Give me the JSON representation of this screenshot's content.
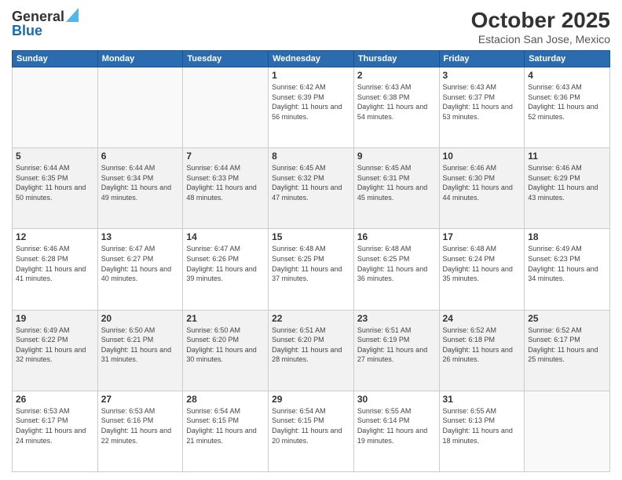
{
  "header": {
    "logo_general": "General",
    "logo_blue": "Blue",
    "month": "October 2025",
    "location": "Estacion San Jose, Mexico"
  },
  "weekdays": [
    "Sunday",
    "Monday",
    "Tuesday",
    "Wednesday",
    "Thursday",
    "Friday",
    "Saturday"
  ],
  "weeks": [
    [
      {
        "day": "",
        "info": ""
      },
      {
        "day": "",
        "info": ""
      },
      {
        "day": "",
        "info": ""
      },
      {
        "day": "1",
        "info": "Sunrise: 6:42 AM\nSunset: 6:39 PM\nDaylight: 11 hours and 56 minutes."
      },
      {
        "day": "2",
        "info": "Sunrise: 6:43 AM\nSunset: 6:38 PM\nDaylight: 11 hours and 54 minutes."
      },
      {
        "day": "3",
        "info": "Sunrise: 6:43 AM\nSunset: 6:37 PM\nDaylight: 11 hours and 53 minutes."
      },
      {
        "day": "4",
        "info": "Sunrise: 6:43 AM\nSunset: 6:36 PM\nDaylight: 11 hours and 52 minutes."
      }
    ],
    [
      {
        "day": "5",
        "info": "Sunrise: 6:44 AM\nSunset: 6:35 PM\nDaylight: 11 hours and 50 minutes."
      },
      {
        "day": "6",
        "info": "Sunrise: 6:44 AM\nSunset: 6:34 PM\nDaylight: 11 hours and 49 minutes."
      },
      {
        "day": "7",
        "info": "Sunrise: 6:44 AM\nSunset: 6:33 PM\nDaylight: 11 hours and 48 minutes."
      },
      {
        "day": "8",
        "info": "Sunrise: 6:45 AM\nSunset: 6:32 PM\nDaylight: 11 hours and 47 minutes."
      },
      {
        "day": "9",
        "info": "Sunrise: 6:45 AM\nSunset: 6:31 PM\nDaylight: 11 hours and 45 minutes."
      },
      {
        "day": "10",
        "info": "Sunrise: 6:46 AM\nSunset: 6:30 PM\nDaylight: 11 hours and 44 minutes."
      },
      {
        "day": "11",
        "info": "Sunrise: 6:46 AM\nSunset: 6:29 PM\nDaylight: 11 hours and 43 minutes."
      }
    ],
    [
      {
        "day": "12",
        "info": "Sunrise: 6:46 AM\nSunset: 6:28 PM\nDaylight: 11 hours and 41 minutes."
      },
      {
        "day": "13",
        "info": "Sunrise: 6:47 AM\nSunset: 6:27 PM\nDaylight: 11 hours and 40 minutes."
      },
      {
        "day": "14",
        "info": "Sunrise: 6:47 AM\nSunset: 6:26 PM\nDaylight: 11 hours and 39 minutes."
      },
      {
        "day": "15",
        "info": "Sunrise: 6:48 AM\nSunset: 6:25 PM\nDaylight: 11 hours and 37 minutes."
      },
      {
        "day": "16",
        "info": "Sunrise: 6:48 AM\nSunset: 6:25 PM\nDaylight: 11 hours and 36 minutes."
      },
      {
        "day": "17",
        "info": "Sunrise: 6:48 AM\nSunset: 6:24 PM\nDaylight: 11 hours and 35 minutes."
      },
      {
        "day": "18",
        "info": "Sunrise: 6:49 AM\nSunset: 6:23 PM\nDaylight: 11 hours and 34 minutes."
      }
    ],
    [
      {
        "day": "19",
        "info": "Sunrise: 6:49 AM\nSunset: 6:22 PM\nDaylight: 11 hours and 32 minutes."
      },
      {
        "day": "20",
        "info": "Sunrise: 6:50 AM\nSunset: 6:21 PM\nDaylight: 11 hours and 31 minutes."
      },
      {
        "day": "21",
        "info": "Sunrise: 6:50 AM\nSunset: 6:20 PM\nDaylight: 11 hours and 30 minutes."
      },
      {
        "day": "22",
        "info": "Sunrise: 6:51 AM\nSunset: 6:20 PM\nDaylight: 11 hours and 28 minutes."
      },
      {
        "day": "23",
        "info": "Sunrise: 6:51 AM\nSunset: 6:19 PM\nDaylight: 11 hours and 27 minutes."
      },
      {
        "day": "24",
        "info": "Sunrise: 6:52 AM\nSunset: 6:18 PM\nDaylight: 11 hours and 26 minutes."
      },
      {
        "day": "25",
        "info": "Sunrise: 6:52 AM\nSunset: 6:17 PM\nDaylight: 11 hours and 25 minutes."
      }
    ],
    [
      {
        "day": "26",
        "info": "Sunrise: 6:53 AM\nSunset: 6:17 PM\nDaylight: 11 hours and 24 minutes."
      },
      {
        "day": "27",
        "info": "Sunrise: 6:53 AM\nSunset: 6:16 PM\nDaylight: 11 hours and 22 minutes."
      },
      {
        "day": "28",
        "info": "Sunrise: 6:54 AM\nSunset: 6:15 PM\nDaylight: 11 hours and 21 minutes."
      },
      {
        "day": "29",
        "info": "Sunrise: 6:54 AM\nSunset: 6:15 PM\nDaylight: 11 hours and 20 minutes."
      },
      {
        "day": "30",
        "info": "Sunrise: 6:55 AM\nSunset: 6:14 PM\nDaylight: 11 hours and 19 minutes."
      },
      {
        "day": "31",
        "info": "Sunrise: 6:55 AM\nSunset: 6:13 PM\nDaylight: 11 hours and 18 minutes."
      },
      {
        "day": "",
        "info": ""
      }
    ]
  ]
}
